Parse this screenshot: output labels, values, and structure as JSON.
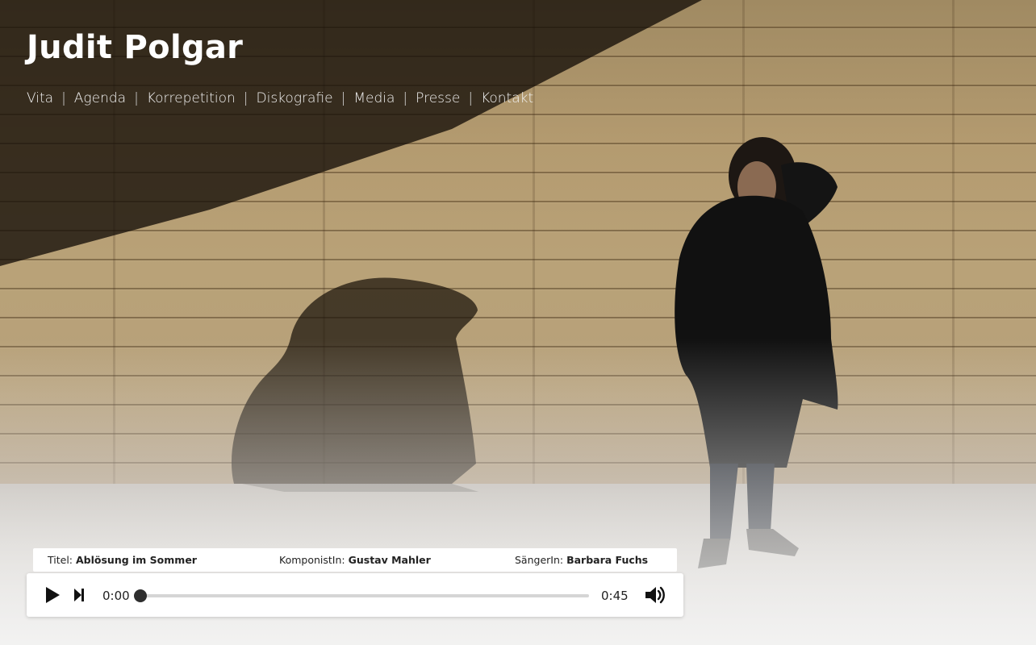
{
  "site": {
    "title": "Judit Polgar"
  },
  "nav": {
    "items": [
      "Vita",
      "Agenda",
      "Korrepetition",
      "Diskografie",
      "Media",
      "Presse",
      "Kontakt"
    ],
    "separator": "|"
  },
  "background": {
    "image": "photo-wooden-wall-woman-in-black-coat"
  },
  "track": {
    "title_label": "Titel:",
    "title": "Ablösung im Sommer",
    "composer_label": "KomponistIn:",
    "composer": "Gustav Mahler",
    "singer_label": "SängerIn:",
    "singer": "Barbara Fuchs"
  },
  "player": {
    "play_icon": "play-icon",
    "next_icon": "skip-next-icon",
    "volume_icon": "volume-icon",
    "current_time": "0:00",
    "duration": "0:45",
    "progress": 0.0
  },
  "colors": {
    "title_text": "#ffffff",
    "nav_text": "#f2f2f2",
    "player_bg": "#ffffff",
    "progress_track": "#d5d5d5",
    "thumb": "#2e2e2e"
  }
}
